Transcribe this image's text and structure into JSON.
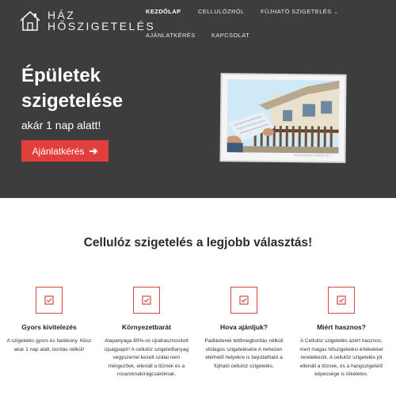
{
  "brand": {
    "line1": "HÁZ",
    "line2": "HŐSZIGETELÉS",
    "logo_icon": "house-icon"
  },
  "nav": {
    "items": [
      {
        "label": "KEZDŐLAP",
        "active": true
      },
      {
        "label": "CELLULÓZRÓL",
        "active": false
      },
      {
        "label": "FÚJHATÓ SZIGETELÉS",
        "active": false,
        "has_dropdown": true
      },
      {
        "label": "AJÁNLATKÉRÉS",
        "active": false
      },
      {
        "label": "KAPCSOLAT",
        "active": false
      }
    ]
  },
  "hero": {
    "title_line1": "Épületek",
    "title_line2": "szigetelése",
    "subtitle": "akár 1 nap alatt!",
    "cta_label": "Ajánlatkérés",
    "cta_icon": "arrow-right-icon",
    "image_caption": "POSTERIZED PHOTO BY ?",
    "colors": {
      "background": "#3d3d3d",
      "accent": "#e23e3c"
    }
  },
  "section": {
    "title": "Cellulóz szigetelés a legjobb választás!"
  },
  "features": [
    {
      "icon": "checkbox-icon",
      "title": "Gyors kivitelezés",
      "text": "A szigetelés gyors és hatékony. Kész akár 1 nap alatt, bontás nélkül!"
    },
    {
      "icon": "checkbox-icon",
      "title": "Környezetbarát",
      "text": "Alapanyaga 80%-os újrahasznosított újságpapír! A cellulóz szigetelőanyag vegyszerrel kezelt szálai nem mérgezőek, ellenáll a tűznek és a rovaroknak/rágcsálóknak."
    },
    {
      "icon": "checkbox-icon",
      "title": "Hova ajánljuk?",
      "text": "Padlásterek tetőmegbontás nélküli utólagos szigetelésére A nehezen elérhető helyekre is bejuttatható a fújható cellulóz szigetelés."
    },
    {
      "icon": "checkbox-icon",
      "title": "Miért hasznos?",
      "text": "A Cellulóz szigetelés azért hasznos, mert magas hőszigetelési értékekkel rendelkezik. A cellulóz szigetelés jól ellenáll a tűznek, és a hangszigetelő képessége is tökéletes."
    }
  ]
}
